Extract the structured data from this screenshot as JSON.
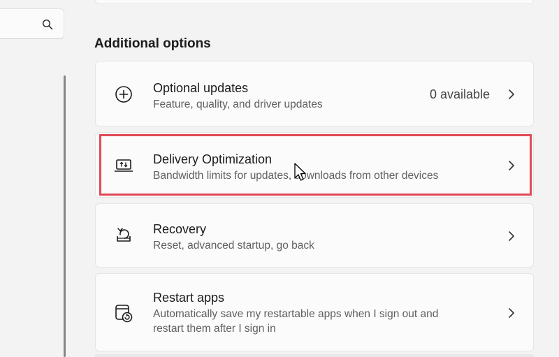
{
  "search": {
    "placeholder": ""
  },
  "section": {
    "title": "Additional options"
  },
  "items": [
    {
      "icon": "plus-circle-icon",
      "title": "Optional updates",
      "subtitle": "Feature, quality, and driver updates",
      "value": "0 available"
    },
    {
      "icon": "delivery-optimization-icon",
      "title": "Delivery Optimization",
      "subtitle": "Bandwidth limits for updates, downloads from other devices"
    },
    {
      "icon": "recovery-icon",
      "title": "Recovery",
      "subtitle": "Reset, advanced startup, go back"
    },
    {
      "icon": "restart-apps-icon",
      "title": "Restart apps",
      "subtitle": "Automatically save my restartable apps when I sign out and restart them after I sign in"
    }
  ],
  "colors": {
    "highlight": "#e04a57",
    "background": "#f3f3f3",
    "card": "#fbfbfb"
  }
}
